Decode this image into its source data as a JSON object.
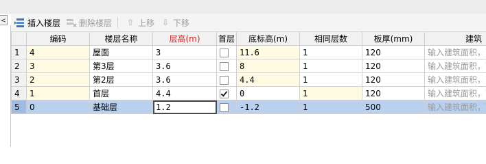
{
  "toolbar": {
    "insert_floor": "插入楼层",
    "delete_floor": "删除楼层",
    "move_up": "上移",
    "move_down": "下移"
  },
  "table": {
    "columns": [
      "",
      "编码",
      "楼层名称",
      "层高(m)",
      "首层",
      "底标高(m)",
      "相同层数",
      "板厚(mm)",
      "建筑"
    ],
    "active_column": "层高(m)",
    "rows": [
      {
        "num": "1",
        "code": "4",
        "name": "屋面",
        "height": "3",
        "first": false,
        "bottom": "11.6",
        "same": "1",
        "thickness": "120",
        "area": "输入建筑面积，可"
      },
      {
        "num": "2",
        "code": "3",
        "name": "第3层",
        "height": "3.6",
        "first": false,
        "bottom": "8",
        "same": "1",
        "thickness": "120",
        "area": "输入建筑面积，可"
      },
      {
        "num": "3",
        "code": "2",
        "name": "第2层",
        "height": "3.6",
        "first": false,
        "bottom": "4.4",
        "same": "1",
        "thickness": "120",
        "area": "输入建筑面积，可"
      },
      {
        "num": "4",
        "code": "1",
        "name": "首层",
        "height": "4.4",
        "first": true,
        "bottom": "0",
        "same": "1",
        "thickness": "120",
        "area": "输入建筑面积，可"
      },
      {
        "num": "5",
        "code": "0",
        "name": "基础层",
        "height": "1.2",
        "first": false,
        "bottom": "-1.2",
        "same": "1",
        "thickness": "500",
        "area": "输入建筑面积，可"
      }
    ],
    "selected_row": "5"
  },
  "icons": {
    "insert": "insert-floor-icon",
    "delete": "delete-floor-icon",
    "up": "up-arrow-icon",
    "down": "down-arrow-icon",
    "collapse": "collapse-left-icon"
  },
  "colors": {
    "active_header_bg": "#fcdcae",
    "active_header_text": "#d21f1f",
    "selected_row_bg": "#b9d1ef",
    "editable_cell_bg": "#fffbe2"
  }
}
